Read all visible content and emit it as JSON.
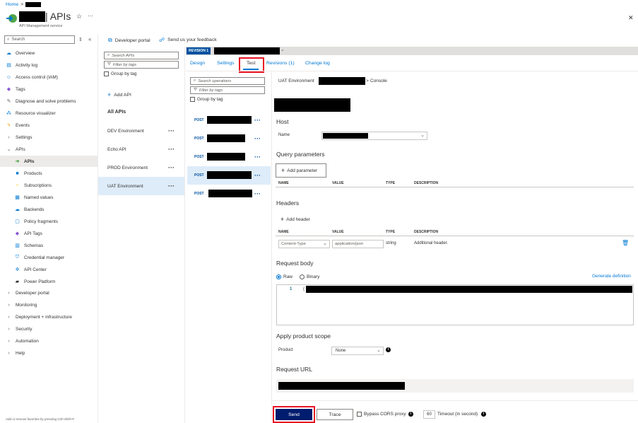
{
  "breadcrumb": {
    "home": "Home",
    "sep": ">"
  },
  "header": {
    "title": "| APIs",
    "subtitle": "API Management service",
    "star": "☆",
    "more": "···",
    "close": "✕"
  },
  "sidebar": {
    "search_placeholder": "Search",
    "items": [
      {
        "label": "Overview"
      },
      {
        "label": "Activity log"
      },
      {
        "label": "Access control (IAM)"
      },
      {
        "label": "Tags"
      },
      {
        "label": "Diagnose and solve problems"
      },
      {
        "label": "Resource visualizer"
      },
      {
        "label": "Events"
      },
      {
        "label": "Settings"
      },
      {
        "label": "APIs"
      }
    ],
    "apis_sub": [
      {
        "label": "APIs"
      },
      {
        "label": "Products"
      },
      {
        "label": "Subscriptions"
      },
      {
        "label": "Named values"
      },
      {
        "label": "Backends"
      },
      {
        "label": "Policy fragments"
      },
      {
        "label": "API Tags"
      },
      {
        "label": "Schemas"
      },
      {
        "label": "Credential manager"
      },
      {
        "label": "API Center"
      },
      {
        "label": "Power Platform"
      }
    ],
    "groups": [
      {
        "label": "Developer portal"
      },
      {
        "label": "Monitoring"
      },
      {
        "label": "Deployment + infrastructure"
      },
      {
        "label": "Security"
      },
      {
        "label": "Automation"
      },
      {
        "label": "Help"
      }
    ],
    "footer": "Add or remove favorites by pressing Ctrl+Shift+F"
  },
  "toolbar": {
    "dev_portal": "Developer portal",
    "feedback": "Send us your feedback"
  },
  "api_list": {
    "search_placeholder": "Search APIs",
    "filter_placeholder": "Filter by tags",
    "group_by": "Group by tag",
    "add_api": "Add API",
    "all_apis": "All APIs",
    "items": [
      {
        "label": "DEV Environment"
      },
      {
        "label": "Echo API"
      },
      {
        "label": "PROD Environment"
      },
      {
        "label": "UAT Environment"
      }
    ]
  },
  "revision": {
    "badge": "REVISION 1"
  },
  "tabs": [
    {
      "label": "Design"
    },
    {
      "label": "Settings"
    },
    {
      "label": "Test"
    },
    {
      "label": "Revisions (1)"
    },
    {
      "label": "Change log"
    }
  ],
  "operations": {
    "search_placeholder": "Search operations",
    "filter_placeholder": "Filter by tags",
    "group_by": "Group by tag",
    "method": "POST"
  },
  "console": {
    "breadcrumb_env": "UAT Environment",
    "breadcrumb_sep": ">",
    "breadcrumb_end": "Console",
    "host_title": "Host",
    "name_label": "Name",
    "query_title": "Query parameters",
    "add_parameter": "Add parameter",
    "col_name": "NAME",
    "col_value": "VALUE",
    "col_type": "TYPE",
    "col_desc": "DESCRIPTION",
    "headers_title": "Headers",
    "add_header": "Add header",
    "header_name": "Content-Type",
    "header_value": "application/json",
    "header_type": "string",
    "header_desc": "Additional header.",
    "body_title": "Request body",
    "raw": "Raw",
    "binary": "Binary",
    "generate": "Generate definition",
    "line_no": "1",
    "line_start": "{",
    "scope_title": "Apply product scope",
    "product_label": "Product",
    "product_value": "None",
    "url_title": "Request URL",
    "send": "Send",
    "trace": "Trace",
    "bypass": "Bypass CORS proxy",
    "timeout_value": "60",
    "timeout_label": "Timeout (in second)"
  }
}
